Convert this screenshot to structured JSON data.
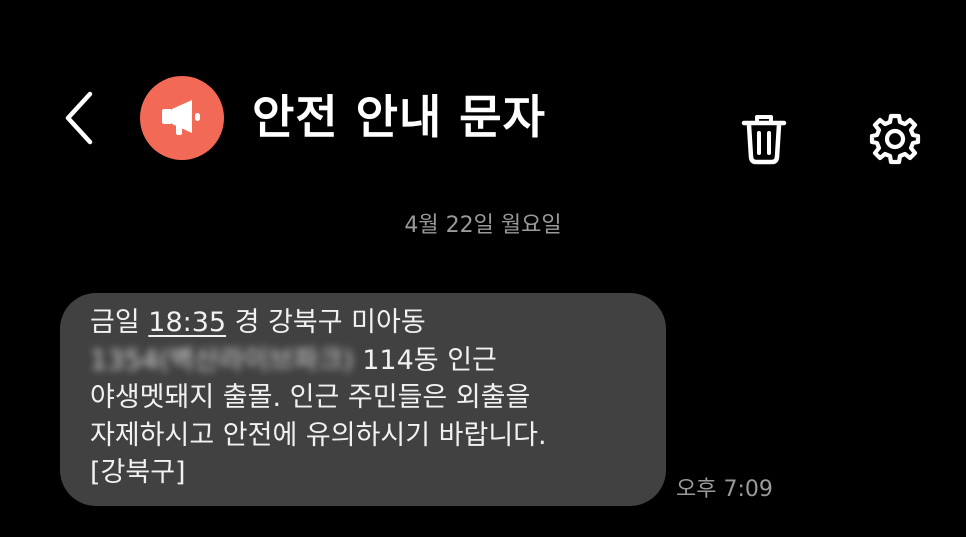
{
  "header": {
    "title": "안전 안내 문자",
    "avatar_color": "#f26a55"
  },
  "icons": {
    "back": "chevron-left-icon",
    "avatar": "megaphone-icon",
    "delete": "trash-icon",
    "settings": "gear-icon"
  },
  "conversation": {
    "date_separator": "4월 22일 월요일",
    "message": {
      "line1_prefix": "금일 ",
      "line1_time": "18:35",
      "line1_suffix": " 경 강북구 미아동",
      "line2_redacted": "1354(벽산라이브파크)",
      "line2_suffix": " 114동 인근",
      "line3": "야생멧돼지 출몰. 인근 주민들은 외출을",
      "line4": "자제하시고 안전에 유의하시기 바랍니다.",
      "line5": "[강북구]",
      "bubble_color": "#414141"
    },
    "timestamp": "오후 7:09"
  }
}
